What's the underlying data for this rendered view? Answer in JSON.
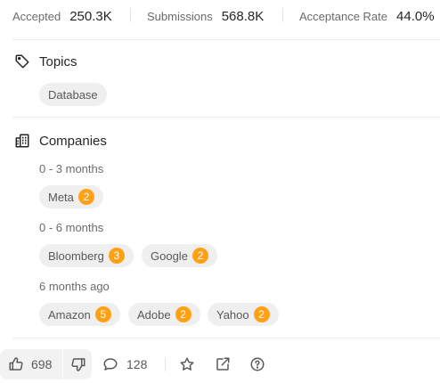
{
  "stats": [
    {
      "label": "Accepted",
      "value": "250.3K"
    },
    {
      "label": "Submissions",
      "value": "568.8K"
    },
    {
      "label": "Acceptance Rate",
      "value": "44.0%"
    }
  ],
  "topics": {
    "title": "Topics",
    "tags": [
      "Database"
    ]
  },
  "companies": {
    "title": "Companies",
    "groups": [
      {
        "period": "0 - 3 months",
        "items": [
          {
            "name": "Meta",
            "count": "2"
          }
        ]
      },
      {
        "period": "0 - 6 months",
        "items": [
          {
            "name": "Bloomberg",
            "count": "3"
          },
          {
            "name": "Google",
            "count": "2"
          }
        ]
      },
      {
        "period": "6 months ago",
        "items": [
          {
            "name": "Amazon",
            "count": "5"
          },
          {
            "name": "Adobe",
            "count": "2"
          },
          {
            "name": "Yahoo",
            "count": "2"
          }
        ]
      }
    ]
  },
  "actions": {
    "upvotes": "698",
    "comments": "128"
  },
  "colors": {
    "badge": "#ffa116",
    "chip_bg": "#efefef",
    "text_muted": "#6b6b6b"
  }
}
